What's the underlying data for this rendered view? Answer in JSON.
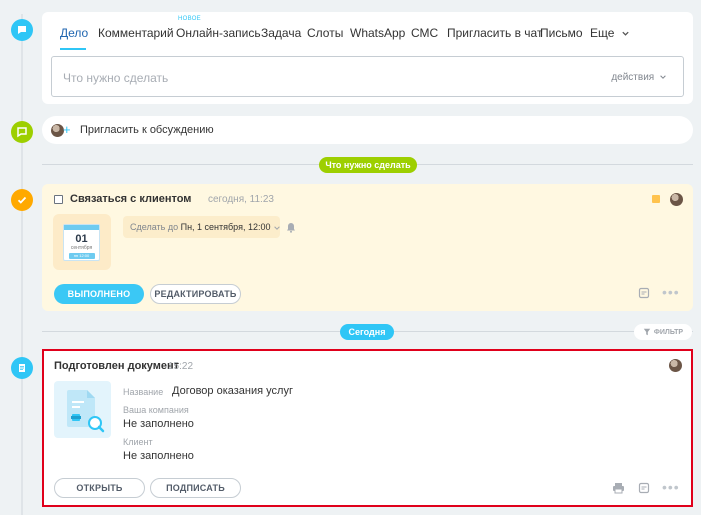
{
  "tabs": [
    {
      "label": "Дело"
    },
    {
      "label": "Комментарий"
    },
    {
      "label": "Онлайн-запись",
      "badge": "НОВОЕ"
    },
    {
      "label": "Задача"
    },
    {
      "label": "Слоты"
    },
    {
      "label": "WhatsApp"
    },
    {
      "label": "СМС"
    },
    {
      "label": "Пригласить в чат"
    },
    {
      "label": "Письмо"
    },
    {
      "label": "Еще"
    }
  ],
  "task_input": {
    "placeholder": "Что нужно сделать",
    "actions_label": "действия"
  },
  "discussion": {
    "label": "Пригласить к обсуждению"
  },
  "section_todo": {
    "label": "Что нужно сделать"
  },
  "task": {
    "title": "Связаться с клиентом",
    "time": "сегодня, 11:23",
    "calendar": {
      "day": "01",
      "month": "сентября",
      "dow": "пн 12:00"
    },
    "deadline_prefix": "Сделать до",
    "deadline_value": "Пн, 1 сентября, 12:00",
    "done_label": "ВЫПОЛНЕНО",
    "edit_label": "РЕДАКТИРОВАТЬ"
  },
  "section_today": {
    "label": "Сегодня"
  },
  "filter": {
    "label": "ФИЛЬТР"
  },
  "document": {
    "title": "Подготовлен документ",
    "time": "15:22",
    "fields": [
      {
        "label": "Название",
        "value": "Договор оказания услуг"
      },
      {
        "label": "Ваша компания",
        "value": "Не заполнено"
      },
      {
        "label": "Клиент",
        "value": "Не заполнено"
      }
    ],
    "open_label": "ОТКРЫТЬ",
    "sign_label": "ПОДПИСАТЬ"
  },
  "colors": {
    "accent": "#2fc6f6",
    "green": "#9dcf00",
    "todo_icon": "#ffa900",
    "card_warm": "#fff8e1",
    "highlight_border": "#e0001b"
  }
}
